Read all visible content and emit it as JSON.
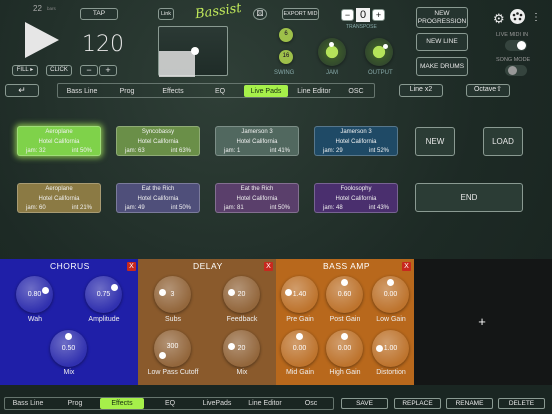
{
  "top": {
    "tempo_small": "22",
    "tempo_small_unit": "bars",
    "tap_label": "TAP",
    "tempo": "120",
    "fill_label": "FILL ▸",
    "click_label": "CLICK",
    "minus": "−",
    "plus": "+",
    "link_label": "Link",
    "logo_text": "Bassist",
    "export_label": "EXPORT MID",
    "transpose_value": "0",
    "transpose_label": "TRANSPOSE",
    "swing_label": "SWING",
    "swing_top": "6",
    "swing_bottom": "16",
    "jam_label": "JAM",
    "output_label": "OUTPUT",
    "new_progression": "NEW PROGRESSION",
    "new_line": "NEW LINE",
    "make_drums": "MAKE DRUMS",
    "live_midi_in": "LIVE MIDI IN",
    "song_mode": "SONG MODE",
    "live_midi_on": true,
    "song_mode_on": false
  },
  "tabs": {
    "enter": "↵",
    "items": [
      "Bass Line",
      "Prog",
      "Effects",
      "EQ",
      "Live Pads",
      "Line Editor",
      "OSC"
    ],
    "active": "Live Pads",
    "line_x2": "Line x2",
    "octave": "Octave⇧"
  },
  "pads": [
    {
      "title": "Aeroplane",
      "song": "Hotel California",
      "jam": "jam: 32",
      "int": "int 50%",
      "color": "#7fd24a",
      "active": true
    },
    {
      "title": "Syncobassy",
      "song": "Hotel California",
      "jam": "jam: 63",
      "int": "int 63%",
      "color": "#6a8f48"
    },
    {
      "title": "Jamerson 3",
      "song": "Hotel California",
      "jam": "jam: 1",
      "int": "int 41%",
      "color": "#51685f"
    },
    {
      "title": "Jamerson 3",
      "song": "Hotel California",
      "jam": "jam: 29",
      "int": "int 52%",
      "color": "#1f4a66"
    },
    {
      "title": "Aeroplane",
      "song": "Hotel California",
      "jam": "jam: 60",
      "int": "int 21%",
      "color": "#8b7a44"
    },
    {
      "title": "Eat the Rich",
      "song": "Hotel California",
      "jam": "jam: 49",
      "int": "int 50%",
      "color": "#4f4f7a"
    },
    {
      "title": "Eat the Rich",
      "song": "Hotel California",
      "jam": "jam: 81",
      "int": "int 50%",
      "color": "#5a3f6b"
    },
    {
      "title": "Foolosophy",
      "song": "Hotel California",
      "jam": "jam: 48",
      "int": "int 43%",
      "color": "#4a2f6e"
    }
  ],
  "pad_buttons": {
    "new": "NEW",
    "load": "LOAD",
    "end": "END"
  },
  "chorus": {
    "title": "CHORUS",
    "close": "X",
    "wah": "0.80",
    "wah_label": "Wah",
    "amplitude": "0.75",
    "amplitude_label": "Amplitude",
    "mix": "0.50",
    "mix_label": "Mix"
  },
  "delay": {
    "title": "DELAY",
    "close": "X",
    "subs": "3",
    "subs_label": "Subs",
    "feedback": "20",
    "feedback_label": "Feedback",
    "lpc": "300",
    "lpc_label": "Low Pass Cutoff",
    "mix": "20",
    "mix_label": "Mix"
  },
  "bassamp": {
    "title": "BASS AMP",
    "close": "X",
    "pre_gain": "1.40",
    "pre_gain_label": "Pre Gain",
    "post_gain": "0.60",
    "post_gain_label": "Post Gain",
    "low_gain": "0.00",
    "low_gain_label": "Low Gain",
    "mid_gain": "0.00",
    "mid_gain_label": "Mid Gain",
    "high_gain": "0.00",
    "high_gain_label": "High Gain",
    "distortion": "1.00",
    "distortion_label": "Distortion"
  },
  "add_effect": "+",
  "bottom": {
    "tabs": [
      "Bass Line",
      "Prog",
      "Effects",
      "EQ",
      "LivePads",
      "Line Editor",
      "Osc"
    ],
    "active": "Effects",
    "save": "SAVE",
    "replace": "REPLACE",
    "rename": "RENAME",
    "delete": "DELETE"
  },
  "colors": {
    "chorus_bg": "#1f1fa8",
    "delay_bg": "#8a5a2c",
    "amp_bg": "#b8681c",
    "accent": "#a6f04a"
  }
}
